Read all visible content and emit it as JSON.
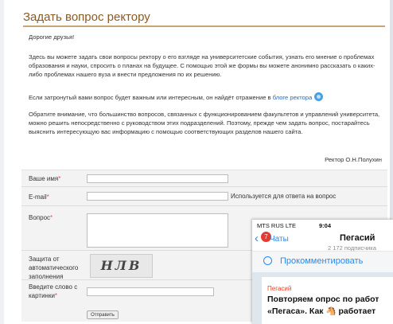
{
  "page": {
    "title": "Задать вопрос ректору",
    "greeting": "Дорогие друзья!",
    "intro": "Здесь вы можете задать свои вопросы ректору о его взгляде на университетские события, узнать его мнение о проблемах образования и науки, спросить о планах на будущее. С помощью этой же формы вы можете анонимно рассказать о каких-либо проблемах нашего вуза и внести предложения по их решению.",
    "blog_text": "Если затронутый вами вопрос будет важным или интересным, он найдёт отражение в",
    "blog_link": "блоге ректора",
    "notice": "Обратите внимание, что большинство вопросов, связанных с функционированием факультетов и управлений университета, можно решить непосредственно с руководством этих подразделений. Поэтому, прежде чем задать вопрос, постарайтесь выяснить интересующую вас информацию с помощью соответствующих разделов нашего сайта.",
    "signature": "Ректор О.Н.Полухин"
  },
  "form": {
    "name_label": "Ваше имя",
    "email_label": "E-mail",
    "email_hint": "Используется для ответа на вопрос",
    "question_label": "Вопрос",
    "captcha_label": "Защита от автоматического заполнения",
    "captcha_text": "НЛВ",
    "captcha_input_label": "Введите слово с картинки",
    "submit_label": "Отправить",
    "required_mark": "*"
  },
  "phone": {
    "carrier": "MTS RUS  LTE",
    "time": "9:04",
    "back_badge": "7",
    "back_label": "Чаты",
    "channel_name": "Пегасий",
    "channel_subscribers": "2 172 подписчика",
    "comment_label": "Прокомментировать",
    "post_channel": "Пегасий",
    "post_line1": "Повторяем опрос по работ",
    "post_line2": "«Пегаса». Как 🐴 работает"
  },
  "colors": {
    "title": "#8b5a23",
    "title_rule": "#c9a77a",
    "link": "#2b6db3",
    "required": "#d9534f",
    "telegram_blue": "#2d89e6",
    "badge_red": "#e53935"
  }
}
